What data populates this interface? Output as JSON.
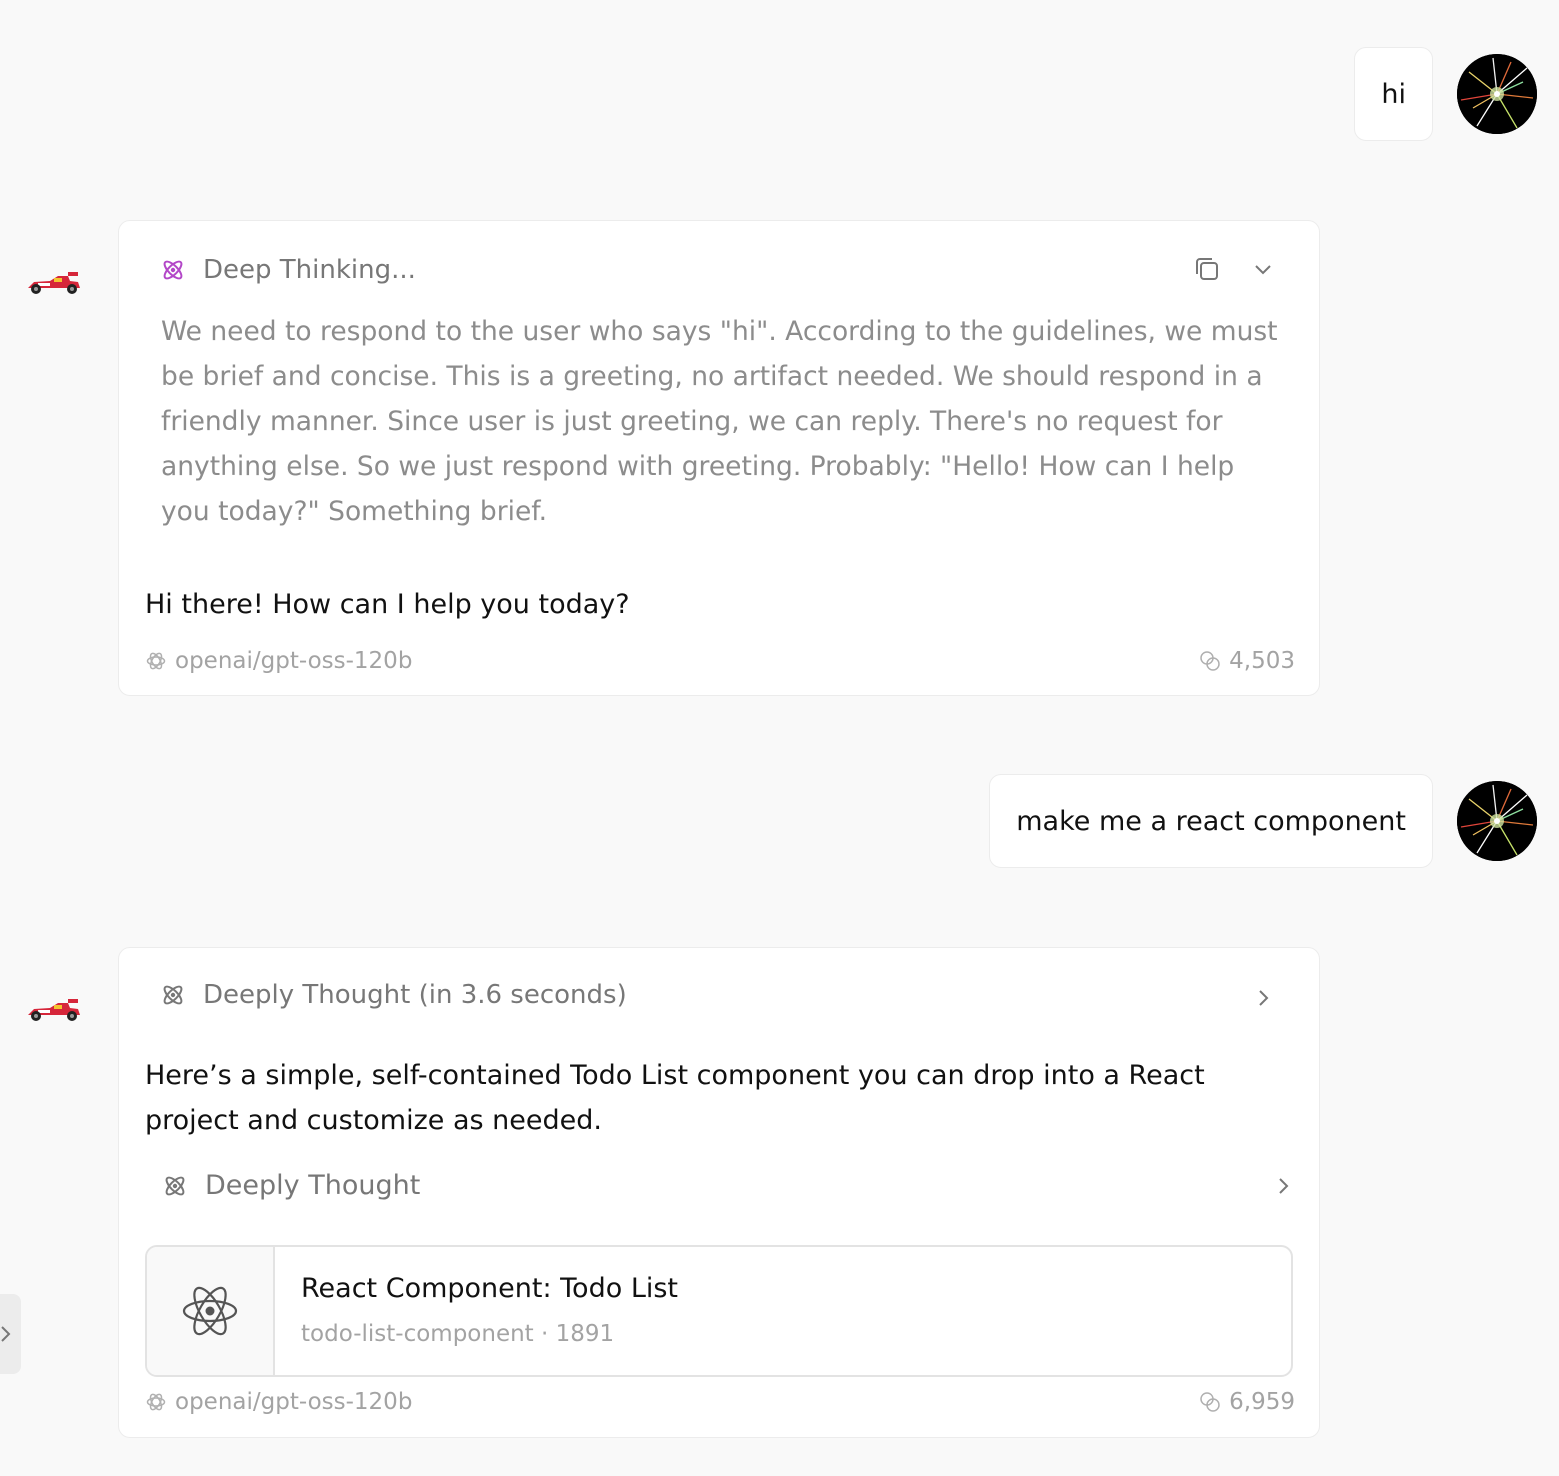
{
  "conversation": {
    "messages": [
      {
        "role": "user",
        "text": "hi"
      },
      {
        "role": "assistant",
        "thinking": {
          "status": "Deep Thinking...",
          "text": "We need to respond to the user who says \"hi\". According to the guidelines, we must be brief and concise. This is a greeting, no artifact needed. We should respond in a friendly manner. Since user is just greeting, we can reply. There's no request for anything else. So we just respond with greeting. Probably: \"Hello! How can I help you today?\" Something brief."
        },
        "reply": "Hi there! How can I help you today?",
        "model": "openai/gpt-oss-120b",
        "tokens": "4,503"
      },
      {
        "role": "user",
        "text": "make me a react component"
      },
      {
        "role": "assistant",
        "thinking": {
          "status": "Deeply Thought (in 3.6 seconds)"
        },
        "reply": "Here’s a simple, self-contained Todo List component you can drop into a React project and customize as needed.",
        "sub_thinking": {
          "status": "Deeply Thought"
        },
        "artifact": {
          "title": "React Component: Todo List",
          "identifier": "todo-list-component",
          "size": "· 1891"
        },
        "model": "openai/gpt-oss-120b",
        "tokens": "6,959"
      }
    ]
  },
  "icons": {
    "assistant_avatar": "race-car-icon",
    "thinking": "atom-icon",
    "copy": "copy-icon",
    "collapse": "chevron-down-icon",
    "expand": "chevron-right-icon",
    "model": "openai-logo-icon",
    "tokens": "coins-icon",
    "artifact": "react-logo-icon"
  },
  "colors": {
    "background": "#f9f9f9",
    "card": "#ffffff",
    "thinking_active_icon": "#b347c8",
    "muted_text": "#8c8c8c"
  }
}
